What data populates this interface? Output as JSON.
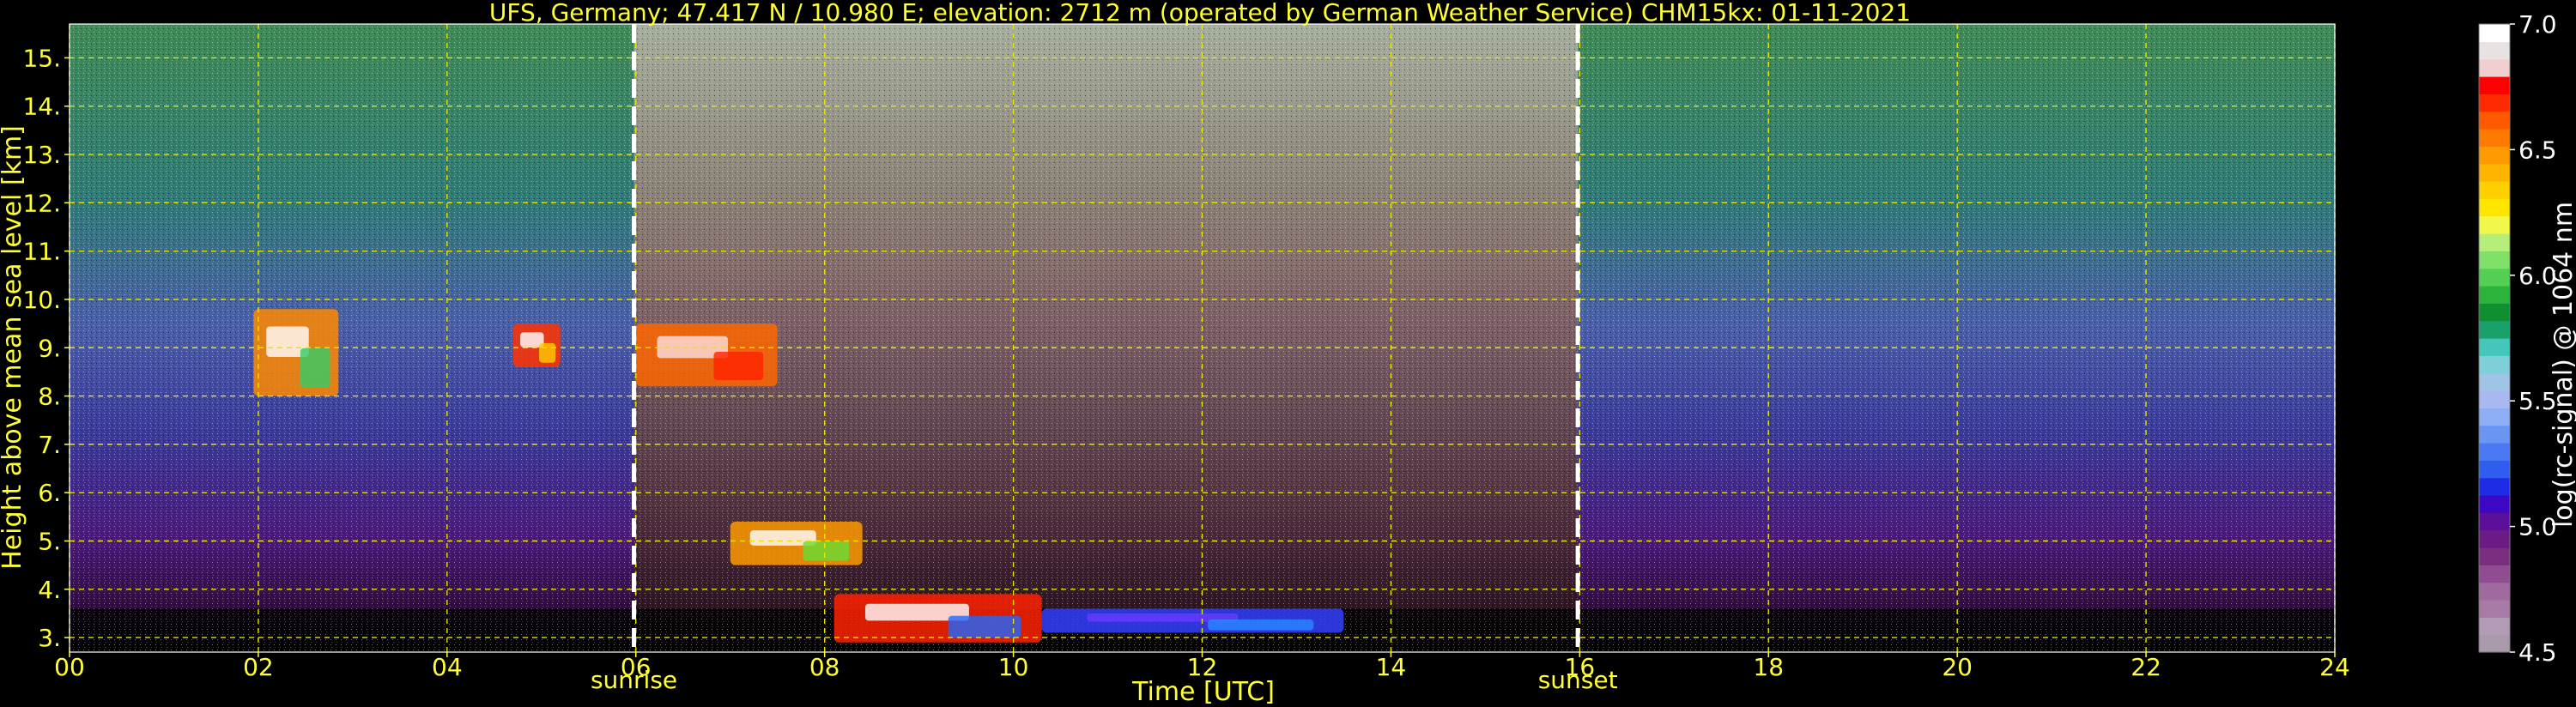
{
  "chart_data": {
    "type": "heatmap",
    "title": "UFS, Germany; 47.417 N / 10.980 E; elevation: 2712 m  (operated by German Weather Service)    CHM15kx: 01-11-2021",
    "xlabel": "Time [UTC]",
    "ylabel": "Height above mean sea level [km]",
    "xlim": [
      0,
      24
    ],
    "ylim": [
      2.7,
      15.7
    ],
    "x_ticks": [
      "00",
      "02",
      "04",
      "06",
      "08",
      "10",
      "12",
      "14",
      "16",
      "18",
      "20",
      "22",
      "24"
    ],
    "y_ticks": [
      "3.",
      "4.",
      "5.",
      "6.",
      "7.",
      "8.",
      "9.",
      "10.",
      "11.",
      "12.",
      "13.",
      "14.",
      "15."
    ],
    "grid": true,
    "markers": [
      {
        "name": "sunrise",
        "label": "sunrise",
        "x": 5.98
      },
      {
        "name": "sunset",
        "label": "sunset",
        "x": 15.98
      }
    ],
    "colorbar": {
      "label": "log(rc-signal) @ 1064 nm",
      "range": [
        4.5,
        7.0
      ],
      "ticks": [
        "4.5",
        "5.0",
        "5.5",
        "6.0",
        "6.5",
        "7.0"
      ],
      "colors": [
        "#a89aab",
        "#b49bb5",
        "#a77ba6",
        "#a06aa0",
        "#8f4c90",
        "#7a2f7e",
        "#6a1b86",
        "#5c0f9a",
        "#3c08c6",
        "#1e2ce6",
        "#2f5df0",
        "#4b79f3",
        "#6a95f2",
        "#8eaef5",
        "#a9b9ef",
        "#9fc4e5",
        "#7fcfd8",
        "#45c6ba",
        "#1aa06a",
        "#0f8f2f",
        "#2bb33b",
        "#53cf53",
        "#7fe06a",
        "#b6ee7a",
        "#f2f84a",
        "#ffe600",
        "#ffcf00",
        "#ffb400",
        "#ff9a00",
        "#ff7a00",
        "#ff5a00",
        "#ff2a00",
        "#ff0000",
        "#f2cfcf",
        "#e9e2e2",
        "#ffffff"
      ]
    },
    "features": [
      {
        "name": "cloud-layer-ice-early",
        "t_start": 1.95,
        "t_end": 2.85,
        "z_low": 8.0,
        "z_high": 9.8
      },
      {
        "name": "cloud-layer-ice-mid",
        "t_start": 4.7,
        "t_end": 5.2,
        "z_low": 8.6,
        "z_high": 9.5
      },
      {
        "name": "cloud-layer-ice-dawn",
        "t_start": 6.0,
        "t_end": 7.5,
        "z_low": 8.2,
        "z_high": 9.5
      },
      {
        "name": "cloud-layer-low",
        "t_start": 7.0,
        "t_end": 8.4,
        "z_low": 4.5,
        "z_high": 5.4
      },
      {
        "name": "cloud-layer-boundary",
        "t_start": 8.1,
        "t_end": 10.3,
        "z_low": 2.9,
        "z_high": 3.9
      },
      {
        "name": "boundary-layer-afternoon",
        "t_start": 10.3,
        "t_end": 13.5,
        "z_low": 3.1,
        "z_high": 3.6
      }
    ]
  }
}
